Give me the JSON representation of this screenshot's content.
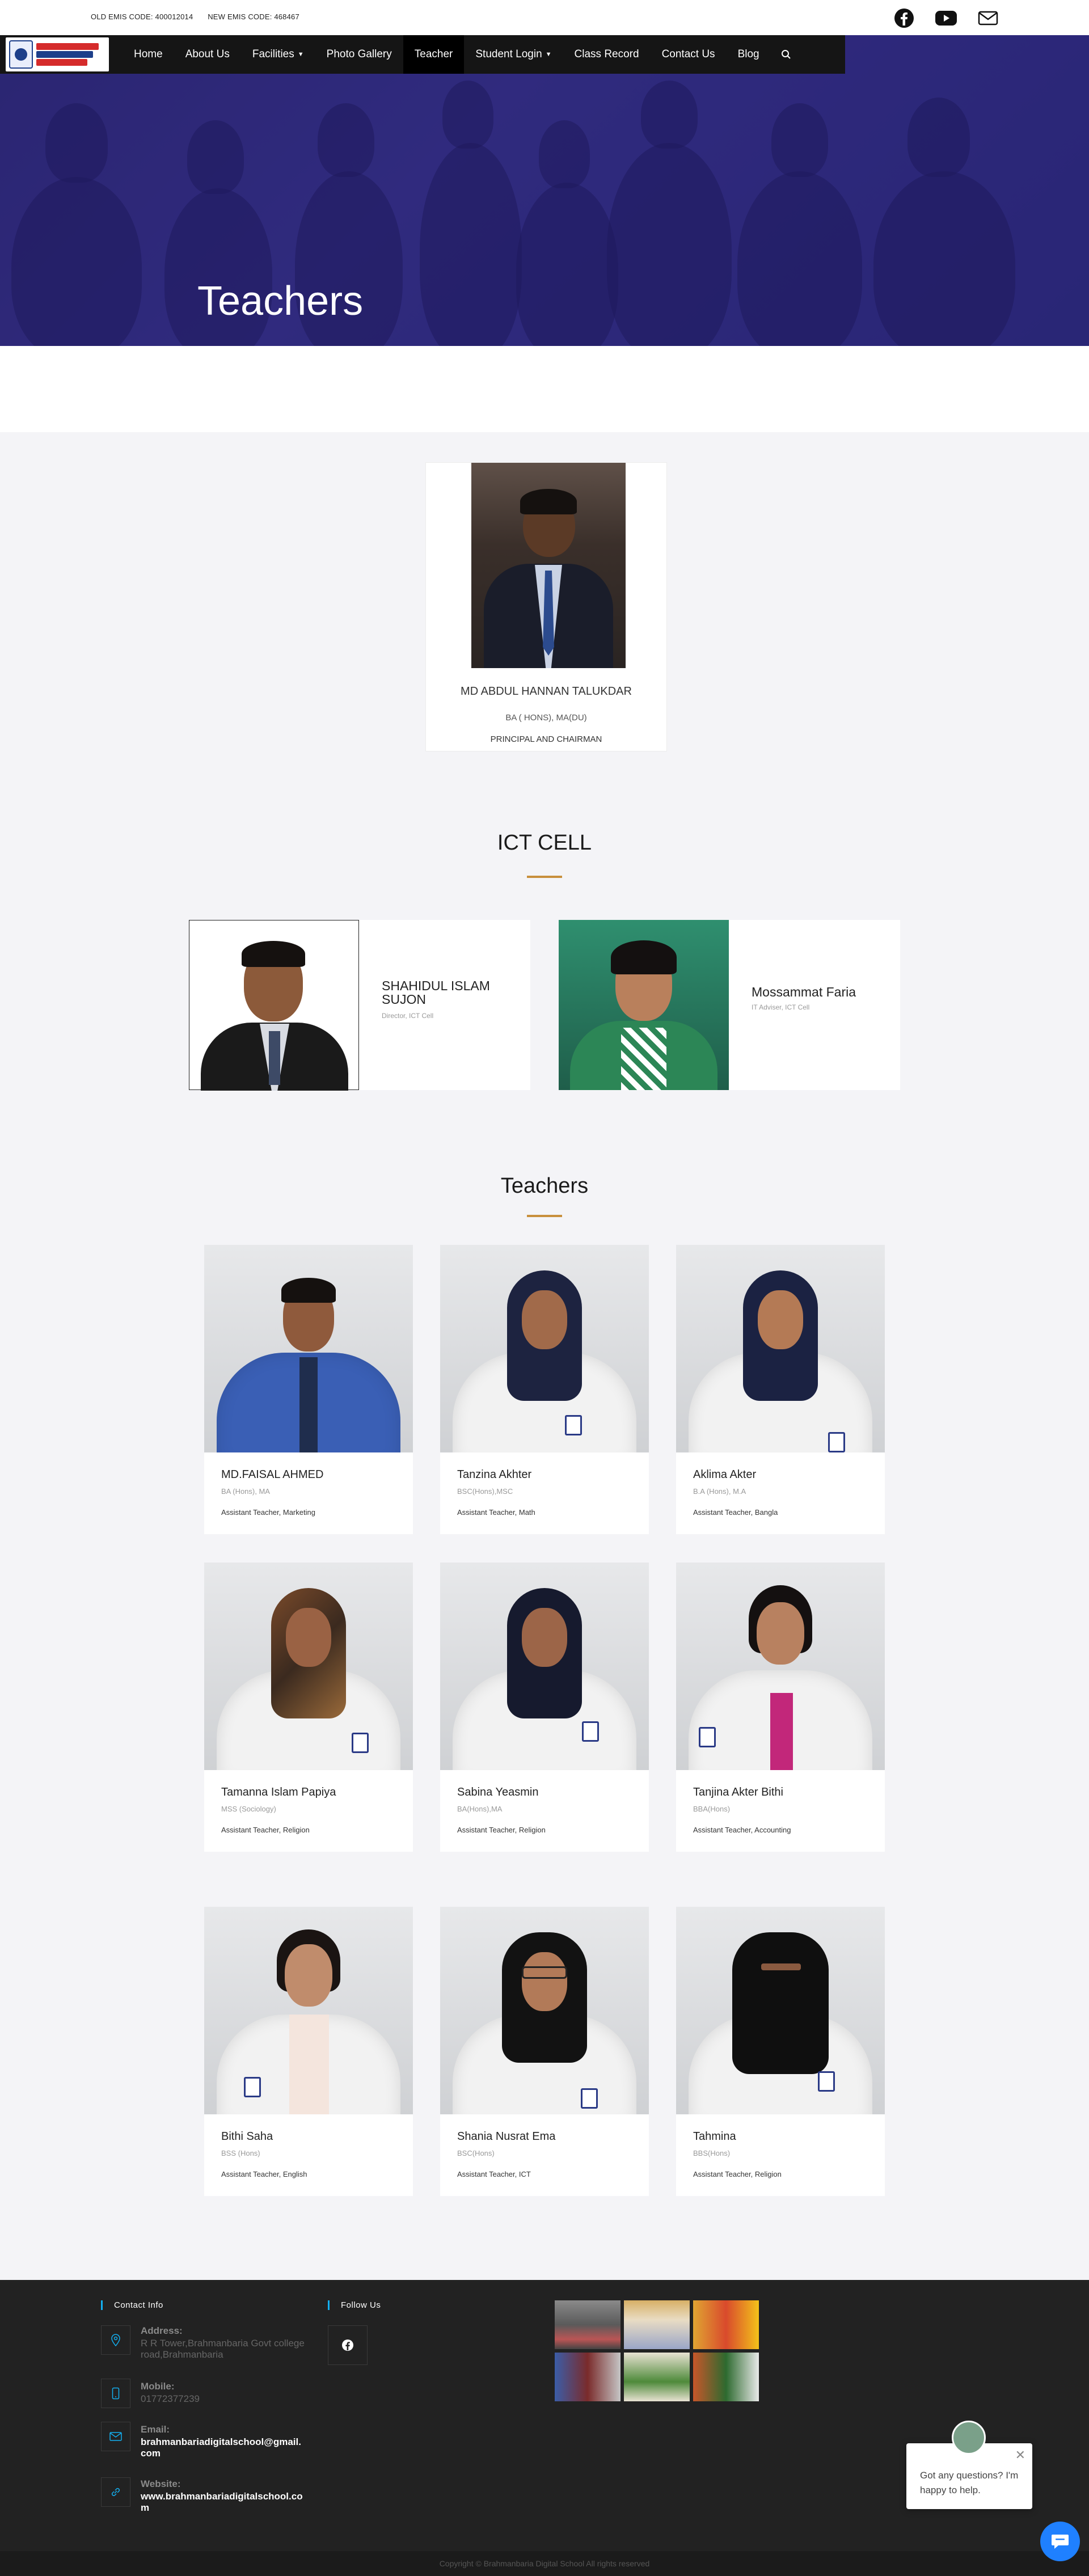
{
  "topbar": {
    "old_code": "OLD EMIS CODE: 400012014",
    "new_code": "NEW EMIS CODE: 468467",
    "socials": [
      "facebook-icon",
      "youtube-icon",
      "mail-icon"
    ]
  },
  "nav": {
    "items": [
      {
        "label": "Home"
      },
      {
        "label": "About Us"
      },
      {
        "label": "Facilities",
        "dropdown": true
      },
      {
        "label": "Photo Gallery"
      },
      {
        "label": "Teacher",
        "active": true
      },
      {
        "label": "Student Login",
        "dropdown": true
      },
      {
        "label": "Class Record"
      },
      {
        "label": "Contact Us"
      },
      {
        "label": "Blog"
      }
    ]
  },
  "hero": {
    "title": "Teachers"
  },
  "principal": {
    "name": "MD ABDUL HANNAN TALUKDAR",
    "degree": "BA ( HONS), MA(DU)",
    "role": "PRINCIPAL AND CHAIRMAN"
  },
  "ict": {
    "title": "ICT CELL",
    "members": [
      {
        "name": "SHAHIDUL ISLAM SUJON",
        "role": "Director, ICT Cell"
      },
      {
        "name": "Mossammat Faria",
        "role": "IT Adviser, ICT Cell"
      }
    ]
  },
  "teachers": {
    "title": "Teachers",
    "list": [
      {
        "name": "MD.FAISAL AHMED",
        "degree": "BA (Hons), MA",
        "role": "Assistant Teacher, Marketing"
      },
      {
        "name": "Tanzina Akhter",
        "degree": "BSC(Hons),MSC",
        "role": "Assistant Teacher, Math"
      },
      {
        "name": "Aklima Akter",
        "degree": "B.A (Hons), M.A",
        "role": "Assistant Teacher, Bangla"
      },
      {
        "name": "Tamanna Islam Papiya",
        "degree": "MSS (Sociology)",
        "role": "Assistant Teacher, Religion"
      },
      {
        "name": "Sabina Yeasmin",
        "degree": "BA(Hons),MA",
        "role": "Assistant Teacher, Religion"
      },
      {
        "name": "Tanjina Akter Bithi",
        "degree": "BBA(Hons)",
        "role": "Assistant Teacher, Accounting"
      },
      {
        "name": "Bithi Saha",
        "degree": "BSS (Hons)",
        "role": "Assistant Teacher, English"
      },
      {
        "name": "Shania Nusrat Ema",
        "degree": "BSC(Hons)",
        "role": "Assistant Teacher, ICT"
      },
      {
        "name": "Tahmina",
        "degree": "BBS(Hons)",
        "role": "Assistant Teacher, Religion"
      }
    ]
  },
  "footer": {
    "contact_heading": "Contact Info",
    "follow_heading": "Follow Us",
    "address_label": "Address:",
    "address_value": "R R Tower,Brahmanbaria Govt college road,Brahmanbaria",
    "mobile_label": "Mobile:",
    "mobile_value": "01772377239",
    "email_label": "Email:",
    "email_value": "brahmanbariadigitalschool@gmail.com",
    "website_label": "Website:",
    "website_value": "www.brahmanbariadigitalschool.com",
    "copyright": "Copyright © Brahmanbaria Digital School All rights reserved"
  },
  "chat": {
    "message": "Got any questions? I'm happy to help."
  },
  "colors": {
    "accent": "#c88f3c",
    "nav": "#151515",
    "footer": "#222222",
    "chat": "#1f80ff"
  }
}
